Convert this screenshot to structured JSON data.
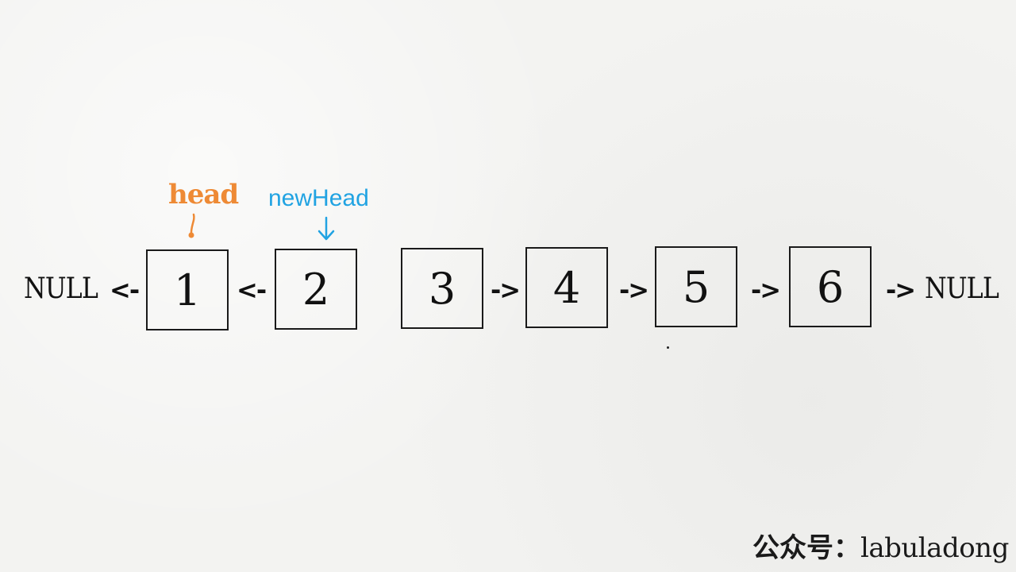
{
  "diagram": {
    "null_left": "NULL",
    "null_right": "NULL",
    "arrow_left": "<-",
    "arrow_right": "->",
    "nodes": [
      "1",
      "2",
      "3",
      "4",
      "5",
      "6"
    ],
    "head_label": "head",
    "newhead_label": "newHead",
    "colors": {
      "head": "#ee8a35",
      "newHead": "#21a3e2",
      "ink": "#111111"
    }
  },
  "watermark": {
    "prefix": "公众号：",
    "handle": "labuladong"
  }
}
